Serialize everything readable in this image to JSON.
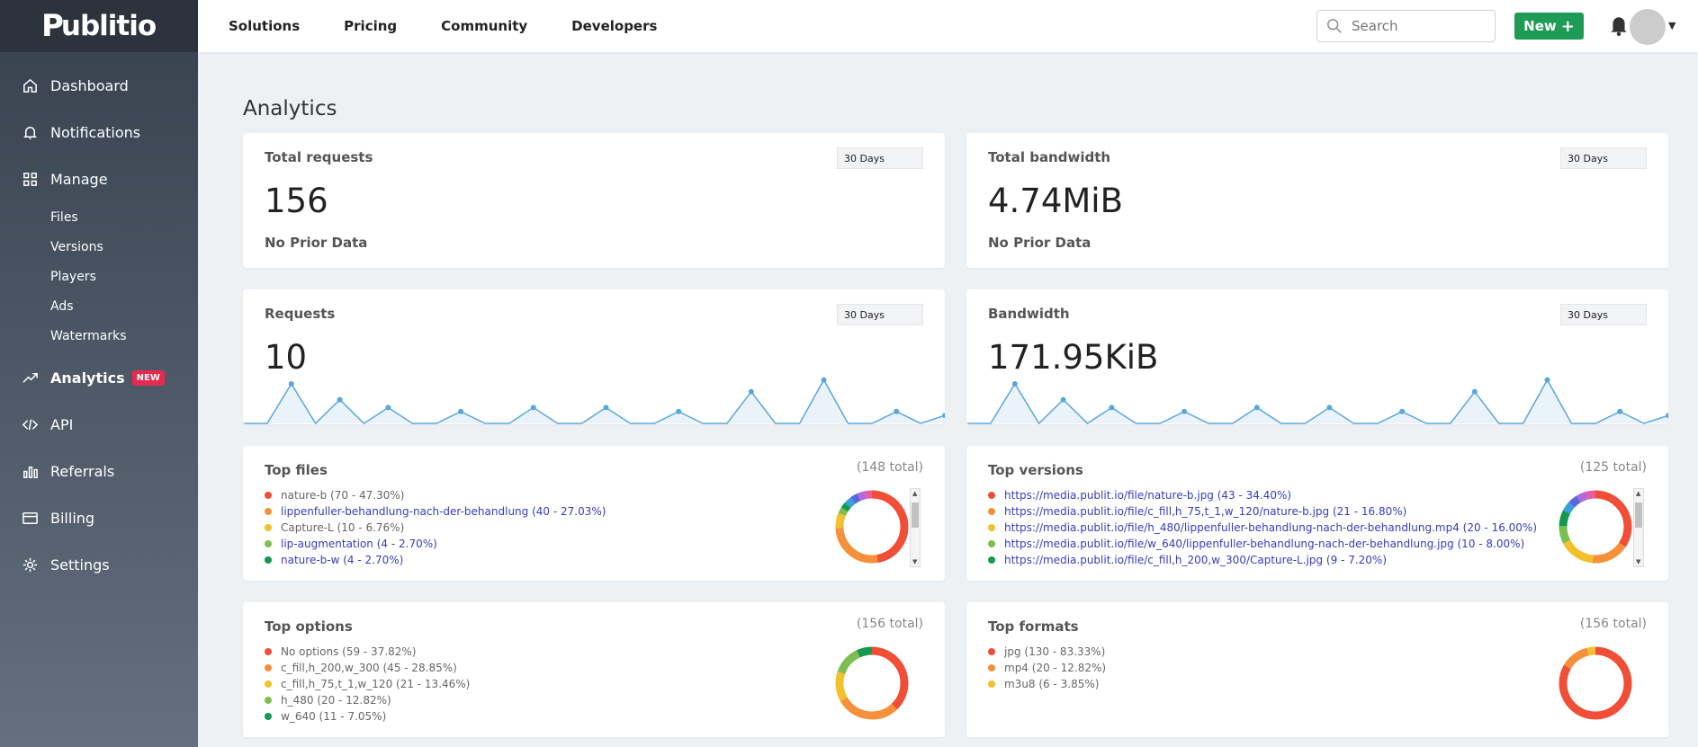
{
  "brand": "ublitio",
  "sidebar": {
    "items": [
      {
        "label": "Dashboard",
        "icon": "home-icon"
      },
      {
        "label": "Notifications",
        "icon": "bell-icon"
      },
      {
        "label": "Manage",
        "icon": "grid-icon"
      },
      {
        "label": "Analytics",
        "icon": "trend-icon",
        "badge": "NEW"
      },
      {
        "label": "API",
        "icon": "code-icon"
      },
      {
        "label": "Referrals",
        "icon": "bars-icon"
      },
      {
        "label": "Billing",
        "icon": "card-icon"
      },
      {
        "label": "Settings",
        "icon": "gear-icon"
      }
    ],
    "manage_sub": [
      "Files",
      "Versions",
      "Players",
      "Ads",
      "Watermarks"
    ]
  },
  "topbar": {
    "menu": [
      "Solutions",
      "Pricing",
      "Community",
      "Developers"
    ],
    "search_placeholder": "Search",
    "new_label": "New"
  },
  "page_title": "Analytics",
  "cards": {
    "total_requests": {
      "title": "Total requests",
      "range": "30 Days",
      "value": "156",
      "note": "No Prior Data"
    },
    "total_bandwidth": {
      "title": "Total bandwidth",
      "range": "30 Days",
      "value": "4.74MiB",
      "note": "No Prior Data"
    },
    "requests": {
      "title": "Requests",
      "range": "30 Days",
      "value": "10"
    },
    "bandwidth": {
      "title": "Bandwidth",
      "range": "30 Days",
      "value": "171.95KiB"
    },
    "top_files": {
      "title": "Top files",
      "total": "(148 total)",
      "items": [
        {
          "label": "nature-b (70 - 47.30%)",
          "link": false,
          "share": 47.3
        },
        {
          "label": "lippenfuller-behandlung-nach-der-behandlung (40 - 27.03%)",
          "link": true,
          "share": 27.03
        },
        {
          "label": "Capture-L (10 - 6.76%)",
          "link": false,
          "share": 6.76
        },
        {
          "label": "lip-augmentation (4 - 2.70%)",
          "link": true,
          "share": 2.7
        },
        {
          "label": "nature-b-w (4 - 2.70%)",
          "link": true,
          "share": 2.7
        }
      ]
    },
    "top_versions": {
      "title": "Top versions",
      "total": "(125 total)",
      "items": [
        {
          "label": "https://media.publit.io/file/nature-b.jpg (43 - 34.40%)",
          "share": 34.4
        },
        {
          "label": "https://media.publit.io/file/c_fill,h_75,t_1,w_120/nature-b.jpg (21 - 16.80%)",
          "share": 16.8
        },
        {
          "label": "https://media.publit.io/file/h_480/lippenfuller-behandlung-nach-der-behandlung.mp4 (20 - 16.00%)",
          "share": 16.0
        },
        {
          "label": "https://media.publit.io/file/w_640/lippenfuller-behandlung-nach-der-behandlung.jpg (10 - 8.00%)",
          "share": 8.0
        },
        {
          "label": "https://media.publit.io/file/c_fill,h_200,w_300/Capture-L.jpg (9 - 7.20%)",
          "share": 7.2
        }
      ]
    },
    "top_options": {
      "title": "Top options",
      "total": "(156 total)",
      "items": [
        {
          "label": "No options (59 - 37.82%)",
          "share": 37.82
        },
        {
          "label": "c_fill,h_200,w_300 (45 - 28.85%)",
          "share": 28.85
        },
        {
          "label": "c_fill,h_75,t_1,w_120 (21 - 13.46%)",
          "share": 13.46
        },
        {
          "label": "h_480 (20 - 12.82%)",
          "share": 12.82
        },
        {
          "label": "w_640 (11 - 7.05%)",
          "share": 7.05
        }
      ]
    },
    "top_formats": {
      "title": "Top formats",
      "total": "(156 total)",
      "items": [
        {
          "label": "jpg (130 - 83.33%)",
          "share": 83.33
        },
        {
          "label": "mp4 (20 - 12.82%)",
          "share": 12.82
        },
        {
          "label": "m3u8 (6 - 3.85%)",
          "share": 3.85
        }
      ]
    }
  },
  "sparkline": [
    0,
    0,
    1,
    0,
    0.6,
    0,
    0.4,
    0,
    0,
    0.3,
    0,
    0,
    0.4,
    0,
    0,
    0.4,
    0,
    0,
    0.3,
    0,
    0,
    0.8,
    0,
    0,
    1.1,
    0,
    0,
    0.3,
    0,
    0.2
  ],
  "colors": {
    "series": [
      "#f04e37",
      "#f5913a",
      "#f2c12e",
      "#7cbf4f",
      "#139950",
      "#3aa0d9",
      "#5867dd",
      "#b06adc",
      "#e95ca5"
    ],
    "accent": "#1e9b55",
    "spark": "#5aa7dc"
  }
}
